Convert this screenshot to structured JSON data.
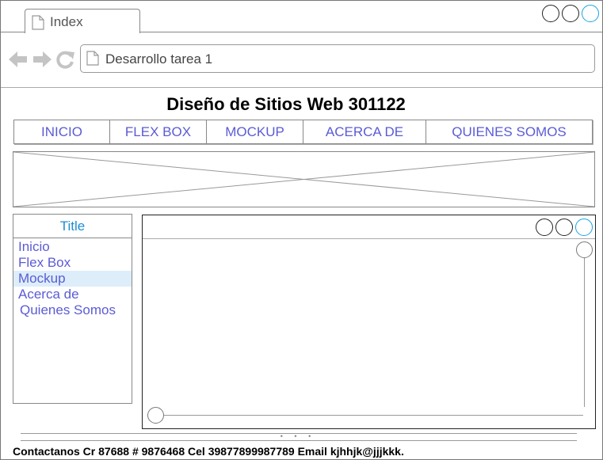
{
  "browser": {
    "tab_label": "Index",
    "address": "Desarrollo tarea 1",
    "window_controls": [
      "minimize-icon",
      "maximize-icon",
      "close-icon"
    ],
    "nav_icons": [
      "back-arrow-icon",
      "forward-arrow-icon",
      "refresh-icon"
    ]
  },
  "page": {
    "title": "Diseño de Sitios Web 301122"
  },
  "menu": {
    "items": [
      {
        "label": "INICIO"
      },
      {
        "label": "FLEX BOX"
      },
      {
        "label": "MOCKUP"
      },
      {
        "label": "ACERCA DE"
      },
      {
        "label": "QUIENES SOMOS"
      }
    ]
  },
  "sidebar": {
    "title": "Title",
    "items": [
      {
        "label": "Inicio"
      },
      {
        "label": "Flex Box"
      },
      {
        "label": "Mockup"
      },
      {
        "label": "Acerca de"
      },
      {
        "label": "Quienes Somos"
      }
    ],
    "selected_index": 2
  },
  "footer": {
    "text": "Contactanos Cr 87688 # 9876468 Cel 39877899987789 Email kjhhjk@jjjkkk."
  },
  "colors": {
    "link": "#5b5bd6",
    "title_accent": "#1b8ed4",
    "selected_bg": "#ddeefa",
    "close_button": "#1ba1e2"
  }
}
